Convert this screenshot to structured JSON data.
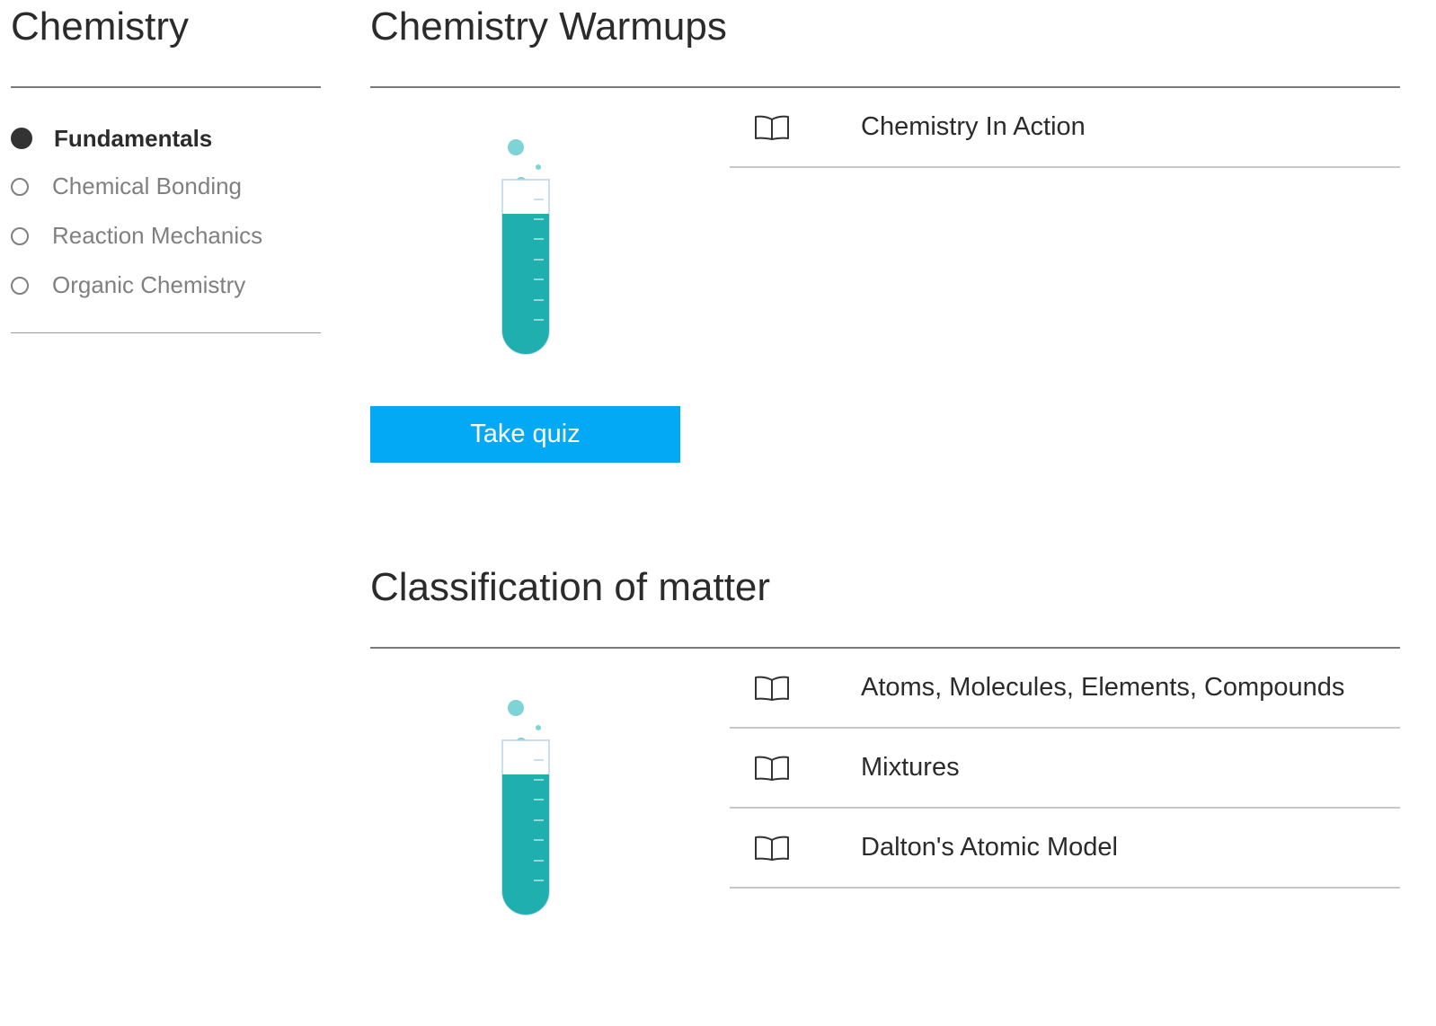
{
  "sidebar": {
    "title": "Chemistry",
    "items": [
      {
        "label": "Fundamentals",
        "active": true
      },
      {
        "label": "Chemical Bonding",
        "active": false
      },
      {
        "label": "Reaction Mechanics",
        "active": false
      },
      {
        "label": "Organic Chemistry",
        "active": false
      }
    ]
  },
  "sections": [
    {
      "title": "Chemistry Warmups",
      "illustration": "test-tube-icon",
      "quiz_button": "Take quiz",
      "lessons": [
        {
          "label": "Chemistry In Action",
          "icon": "book-icon"
        }
      ]
    },
    {
      "title": "Classification of matter",
      "illustration": "test-tube-icon",
      "lessons": [
        {
          "label": "Atoms, Molecules, Elements, Compounds",
          "icon": "book-icon"
        },
        {
          "label": "Mixtures",
          "icon": "book-icon"
        },
        {
          "label": "Dalton's Atomic Model",
          "icon": "book-icon"
        }
      ]
    }
  ],
  "colors": {
    "accent": "#03a9f4",
    "liquid": "#1fafaf",
    "bubble": "#7ed3d6",
    "text": "#2b2b2b",
    "muted": "#808080"
  }
}
